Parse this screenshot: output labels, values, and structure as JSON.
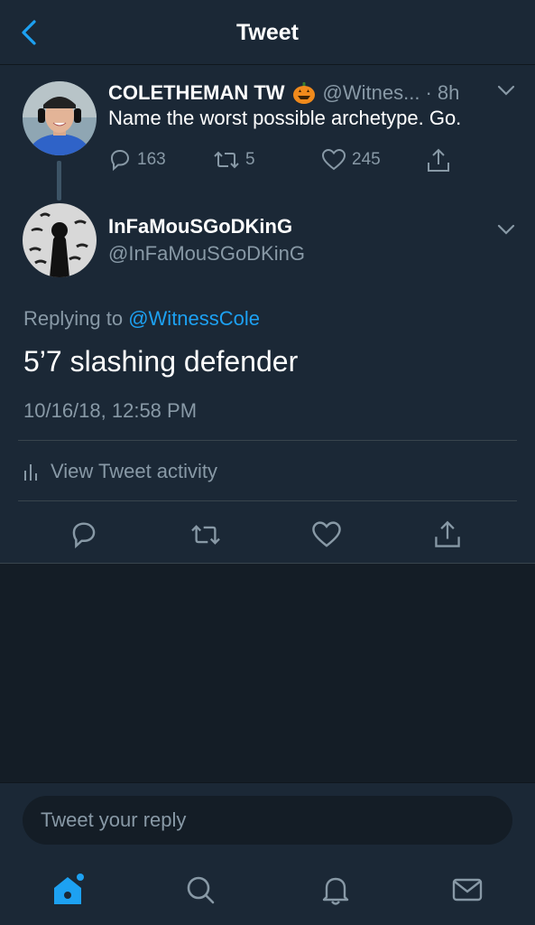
{
  "header": {
    "title": "Tweet",
    "back_icon": "chevron-left-icon"
  },
  "parent_tweet": {
    "display_name": "COLETHEMAN TW",
    "emoji": "pumpkin-emoji",
    "handle_truncated": "@Witnes...",
    "time": "· 8h",
    "text": "Name the worst possible archetype. Go.",
    "replies": "163",
    "retweets": "5",
    "likes": "245"
  },
  "reply_tweet": {
    "display_name": "InFaMouSGoDKinG",
    "handle": "@InFaMouSGoDKinG",
    "replying_prefix": "Replying to",
    "replying_to": "@WitnessCole",
    "text": "5’7 slashing defender",
    "timestamp": "10/16/18, 12:58 PM",
    "activity_label": "View Tweet activity"
  },
  "composer": {
    "placeholder": "Tweet your reply"
  },
  "tab_bar": [
    "home-icon",
    "search-icon",
    "notifications-icon",
    "messages-icon"
  ],
  "colors": {
    "background": "#141d26",
    "surface": "#1b2836",
    "accent": "#1da1f2",
    "muted": "#8899a6",
    "divider": "#38444d"
  }
}
